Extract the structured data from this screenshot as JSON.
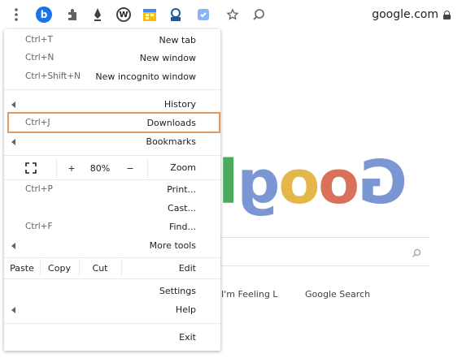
{
  "toolbar": {
    "url": "google.com",
    "extension_badge_letter": "b",
    "extension_w_letter": "W"
  },
  "page": {
    "logo_letters": [
      "G",
      "o",
      "o",
      "g",
      "l"
    ],
    "logo_colors": [
      "#4285F4",
      "#EA4335",
      "#FBBC05",
      "#4285F4",
      "#34A853"
    ],
    "search_button": "Google Search",
    "lucky_button": "I'm Feeling L"
  },
  "menu": {
    "new_tab": {
      "label": "New tab",
      "shortcut": "Ctrl+T"
    },
    "new_window": {
      "label": "New window",
      "shortcut": "Ctrl+N"
    },
    "new_incognito": {
      "label": "New incognito window",
      "shortcut": "Ctrl+Shift+N"
    },
    "history": {
      "label": "History"
    },
    "downloads": {
      "label": "Downloads",
      "shortcut": "Ctrl+J"
    },
    "bookmarks": {
      "label": "Bookmarks"
    },
    "zoom": {
      "label": "Zoom",
      "minus": "−",
      "value": "80%",
      "plus": "+"
    },
    "print": {
      "label": "Print...",
      "shortcut": "Ctrl+P"
    },
    "cast": {
      "label": "Cast..."
    },
    "find": {
      "label": "Find...",
      "shortcut": "Ctrl+F"
    },
    "more_tools": {
      "label": "More tools"
    },
    "edit": {
      "label": "Edit",
      "cut": "Cut",
      "copy": "Copy",
      "paste": "Paste"
    },
    "settings": {
      "label": "Settings"
    },
    "help": {
      "label": "Help"
    },
    "exit": {
      "label": "Exit"
    }
  },
  "colors": {
    "highlight": "#e09a5f",
    "menu_bg": "#ffffff"
  }
}
